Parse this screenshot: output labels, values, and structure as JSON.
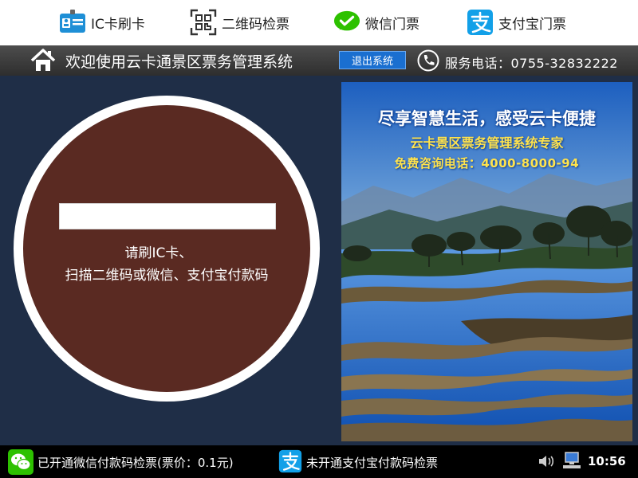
{
  "tabs": [
    {
      "label": "IC卡刷卡",
      "icon": "ic-card-icon"
    },
    {
      "label": "二维码检票",
      "icon": "qr-scan-icon"
    },
    {
      "label": "微信门票",
      "icon": "wechat-icon"
    },
    {
      "label": "支付宝门票",
      "icon": "alipay-icon"
    }
  ],
  "header": {
    "title": "欢迎使用云卡通景区票务管理系统",
    "logout_label": "退出系统",
    "service_text": "服务电话：0755-32832222"
  },
  "main": {
    "input_value": "",
    "prompt_line1": "请刷IC卡、",
    "prompt_line2": "扫描二维码或微信、支付宝付款码"
  },
  "banner": {
    "line1": "尽享智慧生活，感受云卡便捷",
    "line2": "云卡景区票务管理系统专家",
    "line3": "免费咨询电话：4000-8000-94"
  },
  "footer": {
    "wechat_status": "已开通微信付款码检票(票价：0.1元)",
    "alipay_status": "未开通支付宝付款码检票",
    "time": "10:56"
  },
  "colors": {
    "background": "#1f2e47",
    "circle": "#5a2a22",
    "wechat_green": "#2dc100",
    "alipay_blue": "#12a0e8",
    "logout_blue": "#1a6fd0"
  }
}
